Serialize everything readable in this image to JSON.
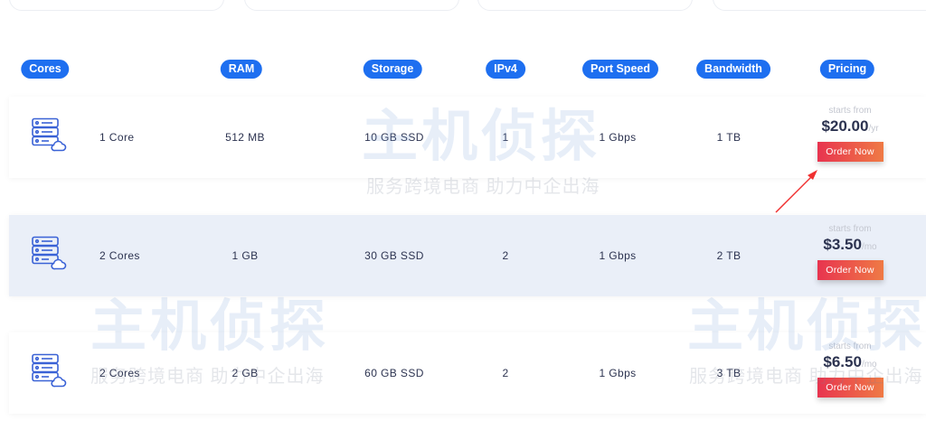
{
  "headers": [
    "Cores",
    "RAM",
    "Storage",
    "IPv4",
    "Port Speed",
    "Bandwidth",
    "Pricing"
  ],
  "rows": [
    {
      "cores": "1 Core",
      "ram": "512 MB",
      "storage": "10 GB SSD",
      "ipv4": "1",
      "port": "1 Gbps",
      "bandwidth": "1 TB",
      "starts": "starts from",
      "price": "$20.00",
      "period": "/yr",
      "order": "Order Now"
    },
    {
      "cores": "2 Cores",
      "ram": "1 GB",
      "storage": "30 GB SSD",
      "ipv4": "2",
      "port": "1 Gbps",
      "bandwidth": "2 TB",
      "starts": "starts from",
      "price": "$3.50",
      "period": "/mo",
      "order": "Order Now"
    },
    {
      "cores": "2 Cores",
      "ram": "2 GB",
      "storage": "60 GB SSD",
      "ipv4": "2",
      "port": "1 Gbps",
      "bandwidth": "3 TB",
      "starts": "starts from",
      "price": "$6.50",
      "period": "/mo",
      "order": "Order Now"
    }
  ],
  "watermark": {
    "title": "主机侦探",
    "slogan": "服务跨境电商 助力中企出海"
  },
  "colors": {
    "accent": "#1e6ff0",
    "order": "#e8344f"
  }
}
